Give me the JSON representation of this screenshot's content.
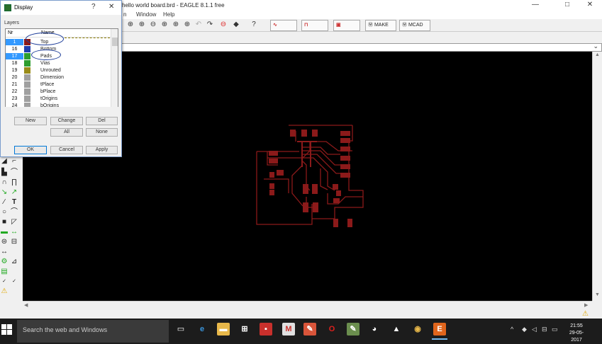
{
  "main_window": {
    "title": "hello world board.brd - EAGLE 8.1.1 free",
    "menu": [
      "Window",
      "Help"
    ],
    "controls": {
      "minimize": "—",
      "maximize": "□",
      "close": "✕"
    }
  },
  "toolbar": {
    "make_label": "MAKE",
    "mcad_label": "MCAD"
  },
  "display_dialog": {
    "title": "Display",
    "help": "?",
    "close": "✕",
    "group_label": "Layers",
    "column_nr": "Nr",
    "column_name": "Name",
    "layers": [
      {
        "nr": "1",
        "name": "Top",
        "color": "#8b1a1a",
        "selected": true
      },
      {
        "nr": "16",
        "name": "Bottom",
        "color": "#1f3fb0",
        "selected": false
      },
      {
        "nr": "17",
        "name": "Pads",
        "color": "#2e9e2e",
        "selected": true
      },
      {
        "nr": "18",
        "name": "Vias",
        "color": "#2e9e2e",
        "selected": false
      },
      {
        "nr": "19",
        "name": "Unrouted",
        "color": "#9a8c1a",
        "selected": false
      },
      {
        "nr": "20",
        "name": "Dimension",
        "color": "#a0a0a0",
        "selected": false
      },
      {
        "nr": "21",
        "name": "tPlace",
        "color": "#a0a0a0",
        "selected": false
      },
      {
        "nr": "22",
        "name": "bPlace",
        "color": "#a0a0a0",
        "selected": false
      },
      {
        "nr": "23",
        "name": "tOrigins",
        "color": "#a0a0a0",
        "selected": false
      },
      {
        "nr": "24",
        "name": "bOrigins",
        "color": "#a0a0a0",
        "selected": false
      }
    ],
    "buttons": {
      "new": "New",
      "change": "Change",
      "del": "Del",
      "all": "All",
      "none": "None",
      "ok": "OK",
      "cancel": "Cancel",
      "apply": "Apply"
    }
  },
  "taskbar": {
    "search_placeholder": "Search the web and Windows",
    "clock_time": "21:55",
    "clock_date": "29-05-2017",
    "eagle_label": "E"
  },
  "colors": {
    "canvas": "#000000",
    "trace": "#8b1a1a",
    "pad": "#8b1a1a",
    "selection": "#3399ff",
    "taskbar": "#1c1c1c",
    "eagle_app": "#e0651c"
  }
}
